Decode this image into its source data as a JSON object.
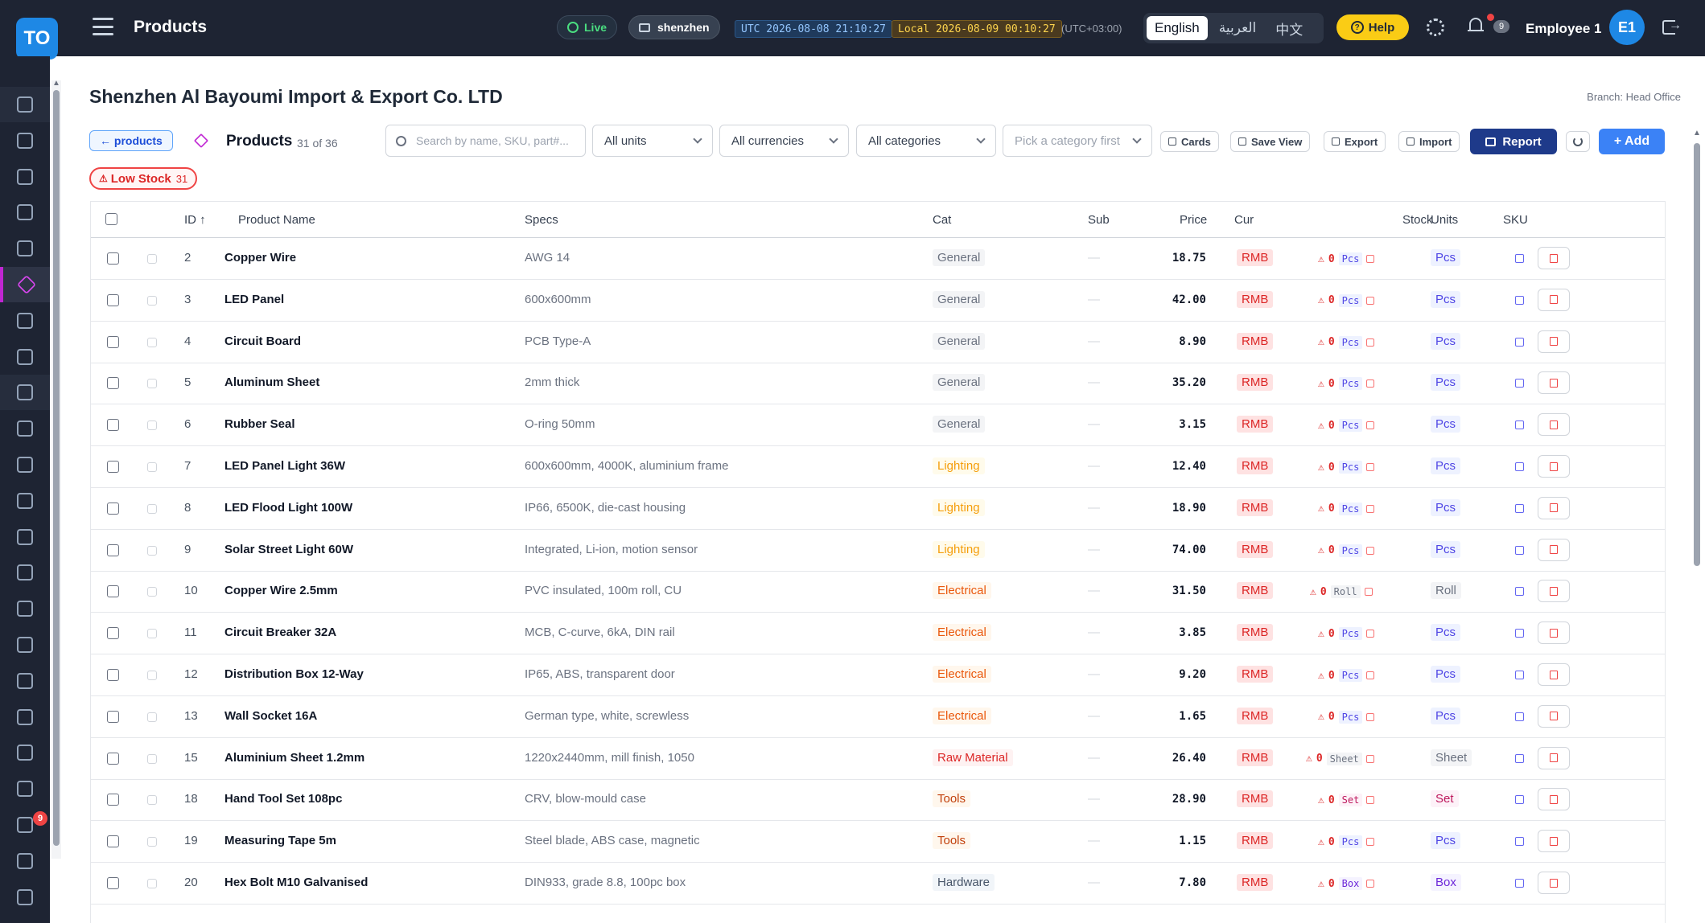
{
  "topbar": {
    "logo": "TO",
    "title": "Products",
    "live": "Live",
    "branch_pill": "shenzhen",
    "utc_clock": "UTC 2026-08-08 21:10:27",
    "local_clock": "Local 2026-08-09 00:10:27",
    "tz": "(UTC+03:00)",
    "languages": [
      "English",
      "العربية",
      "中文"
    ],
    "help": "Help",
    "notif_count": "9",
    "user": "Employee 1",
    "avatar": "E1"
  },
  "sidebar": {
    "badge": "9",
    "items": [
      "dashboard",
      "orders",
      "cart",
      "tasks",
      "archive",
      "products",
      "layers",
      "customers",
      "contacts",
      "accessibility",
      "vehicles",
      "invoices",
      "wallet",
      "bank",
      "documents",
      "book",
      "finance",
      "analytics",
      "links",
      "inbox",
      "campaigns",
      "team",
      "calendar"
    ]
  },
  "header": {
    "company": "Shenzhen Al Bayoumi Import & Export Co. LTD",
    "branch": "Branch: Head Office",
    "back": "← products",
    "products_title": "Products",
    "products_count": "31 of 36"
  },
  "toolbar": {
    "search_placeholder": "Search by name, SKU, part#...",
    "units": "All units",
    "currencies": "All currencies",
    "categories": "All categories",
    "subcategory": "Pick a category first",
    "cards": "Cards",
    "save_view": "Save View",
    "export": "Export",
    "import": "Import",
    "report": "Report",
    "add": "+ Add"
  },
  "filter": {
    "low_stock": "Low Stock",
    "low_stock_count": "31"
  },
  "table": {
    "columns": {
      "id": "ID ↑",
      "name": "Product Name",
      "specs": "Specs",
      "cat": "Cat",
      "sub": "Sub",
      "price": "Price",
      "cur": "Cur",
      "stock": "Stock",
      "units": "Units",
      "sku": "SKU"
    },
    "rows": [
      {
        "id": "2",
        "name": "Copper Wire",
        "specs": "AWG 14",
        "cat": "General",
        "sub": "—",
        "price": "18.75",
        "cur": "RMB",
        "qty": "0",
        "unit": "Pcs"
      },
      {
        "id": "3",
        "name": "LED Panel",
        "specs": "600x600mm",
        "cat": "General",
        "sub": "—",
        "price": "42.00",
        "cur": "RMB",
        "qty": "0",
        "unit": "Pcs"
      },
      {
        "id": "4",
        "name": "Circuit Board",
        "specs": "PCB Type-A",
        "cat": "General",
        "sub": "—",
        "price": "8.90",
        "cur": "RMB",
        "qty": "0",
        "unit": "Pcs"
      },
      {
        "id": "5",
        "name": "Aluminum Sheet",
        "specs": "2mm thick",
        "cat": "General",
        "sub": "—",
        "price": "35.20",
        "cur": "RMB",
        "qty": "0",
        "unit": "Pcs"
      },
      {
        "id": "6",
        "name": "Rubber Seal",
        "specs": "O-ring 50mm",
        "cat": "General",
        "sub": "—",
        "price": "3.15",
        "cur": "RMB",
        "qty": "0",
        "unit": "Pcs"
      },
      {
        "id": "7",
        "name": "LED Panel Light 36W",
        "specs": "600x600mm, 4000K, aluminium frame",
        "cat": "Lighting",
        "sub": "—",
        "price": "12.40",
        "cur": "RMB",
        "qty": "0",
        "unit": "Pcs"
      },
      {
        "id": "8",
        "name": "LED Flood Light 100W",
        "specs": "IP66, 6500K, die-cast housing",
        "cat": "Lighting",
        "sub": "—",
        "price": "18.90",
        "cur": "RMB",
        "qty": "0",
        "unit": "Pcs"
      },
      {
        "id": "9",
        "name": "Solar Street Light 60W",
        "specs": "Integrated, Li-ion, motion sensor",
        "cat": "Lighting",
        "sub": "—",
        "price": "74.00",
        "cur": "RMB",
        "qty": "0",
        "unit": "Pcs"
      },
      {
        "id": "10",
        "name": "Copper Wire 2.5mm",
        "specs": "PVC insulated, 100m roll, CU",
        "cat": "Electrical",
        "sub": "—",
        "price": "31.50",
        "cur": "RMB",
        "qty": "0",
        "unit": "Roll"
      },
      {
        "id": "11",
        "name": "Circuit Breaker 32A",
        "specs": "MCB, C-curve, 6kA, DIN rail",
        "cat": "Electrical",
        "sub": "—",
        "price": "3.85",
        "cur": "RMB",
        "qty": "0",
        "unit": "Pcs"
      },
      {
        "id": "12",
        "name": "Distribution Box 12-Way",
        "specs": "IP65, ABS, transparent door",
        "cat": "Electrical",
        "sub": "—",
        "price": "9.20",
        "cur": "RMB",
        "qty": "0",
        "unit": "Pcs"
      },
      {
        "id": "13",
        "name": "Wall Socket 16A",
        "specs": "German type, white, screwless",
        "cat": "Electrical",
        "sub": "—",
        "price": "1.65",
        "cur": "RMB",
        "qty": "0",
        "unit": "Pcs"
      },
      {
        "id": "15",
        "name": "Aluminium Sheet 1.2mm",
        "specs": "1220x2440mm, mill finish, 1050",
        "cat": "Raw Material",
        "sub": "—",
        "price": "26.40",
        "cur": "RMB",
        "qty": "0",
        "unit": "Sheet"
      },
      {
        "id": "18",
        "name": "Hand Tool Set 108pc",
        "specs": "CRV, blow-mould case",
        "cat": "Tools",
        "sub": "—",
        "price": "28.90",
        "cur": "RMB",
        "qty": "0",
        "unit": "Set"
      },
      {
        "id": "19",
        "name": "Measuring Tape 5m",
        "specs": "Steel blade, ABS case, magnetic",
        "cat": "Tools",
        "sub": "—",
        "price": "1.15",
        "cur": "RMB",
        "qty": "0",
        "unit": "Pcs"
      },
      {
        "id": "20",
        "name": "Hex Bolt M10 Galvanised",
        "specs": "DIN933, grade 8.8, 100pc box",
        "cat": "Hardware",
        "sub": "—",
        "price": "7.80",
        "cur": "RMB",
        "qty": "0",
        "unit": "Box"
      }
    ]
  },
  "colors": {
    "cat": {
      "General": {
        "bg": "#f3f4f6",
        "fg": "#6b7280"
      },
      "Lighting": {
        "bg": "#fffbeb",
        "fg": "#f59e0b"
      },
      "Electrical": {
        "bg": "#fff7ed",
        "fg": "#ea580c"
      },
      "Raw Material": {
        "bg": "#fef2f2",
        "fg": "#dc2626"
      },
      "Tools": {
        "bg": "#fff7ed",
        "fg": "#c2410c"
      },
      "Hardware": {
        "bg": "#f1f5f9",
        "fg": "#475569"
      }
    },
    "unit": {
      "Pcs": {
        "bg": "#eef2ff",
        "fg": "#4f46e5"
      },
      "Roll": {
        "bg": "#f3f4f6",
        "fg": "#6b7280"
      },
      "Sheet": {
        "bg": "#f3f4f6",
        "fg": "#6b7280"
      },
      "Set": {
        "bg": "#fdf2f8",
        "fg": "#be185d"
      },
      "Box": {
        "bg": "#f5f3ff",
        "fg": "#6d28d9"
      }
    }
  }
}
